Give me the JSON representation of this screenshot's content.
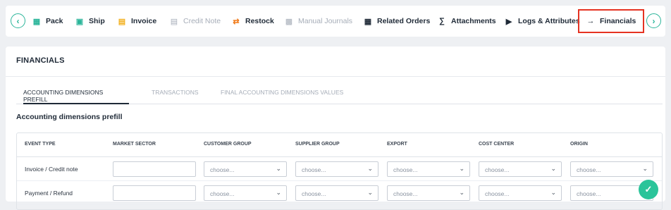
{
  "toolbar": {
    "prev_icon": "chevron-left-icon",
    "next_icon": "chevron-right-icon",
    "tabs": [
      {
        "label": "Pack",
        "icon": "pack-icon",
        "icon_color": "#2bb59a",
        "disabled": false
      },
      {
        "label": "Ship",
        "icon": "ship-icon",
        "icon_color": "#2bb59a",
        "disabled": false
      },
      {
        "label": "Invoice",
        "icon": "invoice-icon",
        "icon_color": "#f2b01e",
        "disabled": false
      },
      {
        "label": "Credit Note",
        "icon": "credit-note-icon",
        "icon_color": "#a6adb8",
        "disabled": true
      },
      {
        "label": "Restock",
        "icon": "restock-icon",
        "icon_color": "#f07a1a",
        "disabled": false
      },
      {
        "label": "Manual Journals",
        "icon": "journal-icon",
        "icon_color": "#a6adb8",
        "disabled": true
      },
      {
        "label": "Related Orders",
        "icon": "calendar-icon",
        "icon_color": "#1f2a37",
        "disabled": false
      },
      {
        "label": "Attachments",
        "icon": "paperclip-icon",
        "icon_color": "#1f2a37",
        "disabled": false
      },
      {
        "label": "Logs & Attributes",
        "icon": "tag-icon",
        "icon_color": "#1f2a37",
        "disabled": false
      },
      {
        "label": "Financials",
        "icon": "arrow-right-icon",
        "icon_color": "#1f2a37",
        "disabled": false,
        "active": true
      }
    ]
  },
  "panel": {
    "title": "FINANCIALS",
    "subtabs": [
      {
        "label": "ACCOUNTING DIMENSIONS PREFILL",
        "active": true
      },
      {
        "label": "TRANSACTIONS",
        "active": false
      },
      {
        "label": "FINAL ACCOUNTING DIMENSIONS VALUES",
        "active": false
      }
    ],
    "section_title": "Accounting dimensions prefill",
    "table": {
      "headers": [
        "EVENT TYPE",
        "MARKET SECTOR",
        "CUSTOMER GROUP",
        "SUPPLIER GROUP",
        "EXPORT",
        "COST CENTER",
        "ORIGIN"
      ],
      "select_placeholder": "choose...",
      "rows": [
        {
          "event_type": "Invoice / Credit note",
          "market_sector": ""
        },
        {
          "event_type": "Payment / Refund",
          "market_sector": ""
        }
      ]
    }
  },
  "colors": {
    "accent": "#2bb59a",
    "highlight_border": "#e53322",
    "fab": "#2bc49a"
  }
}
